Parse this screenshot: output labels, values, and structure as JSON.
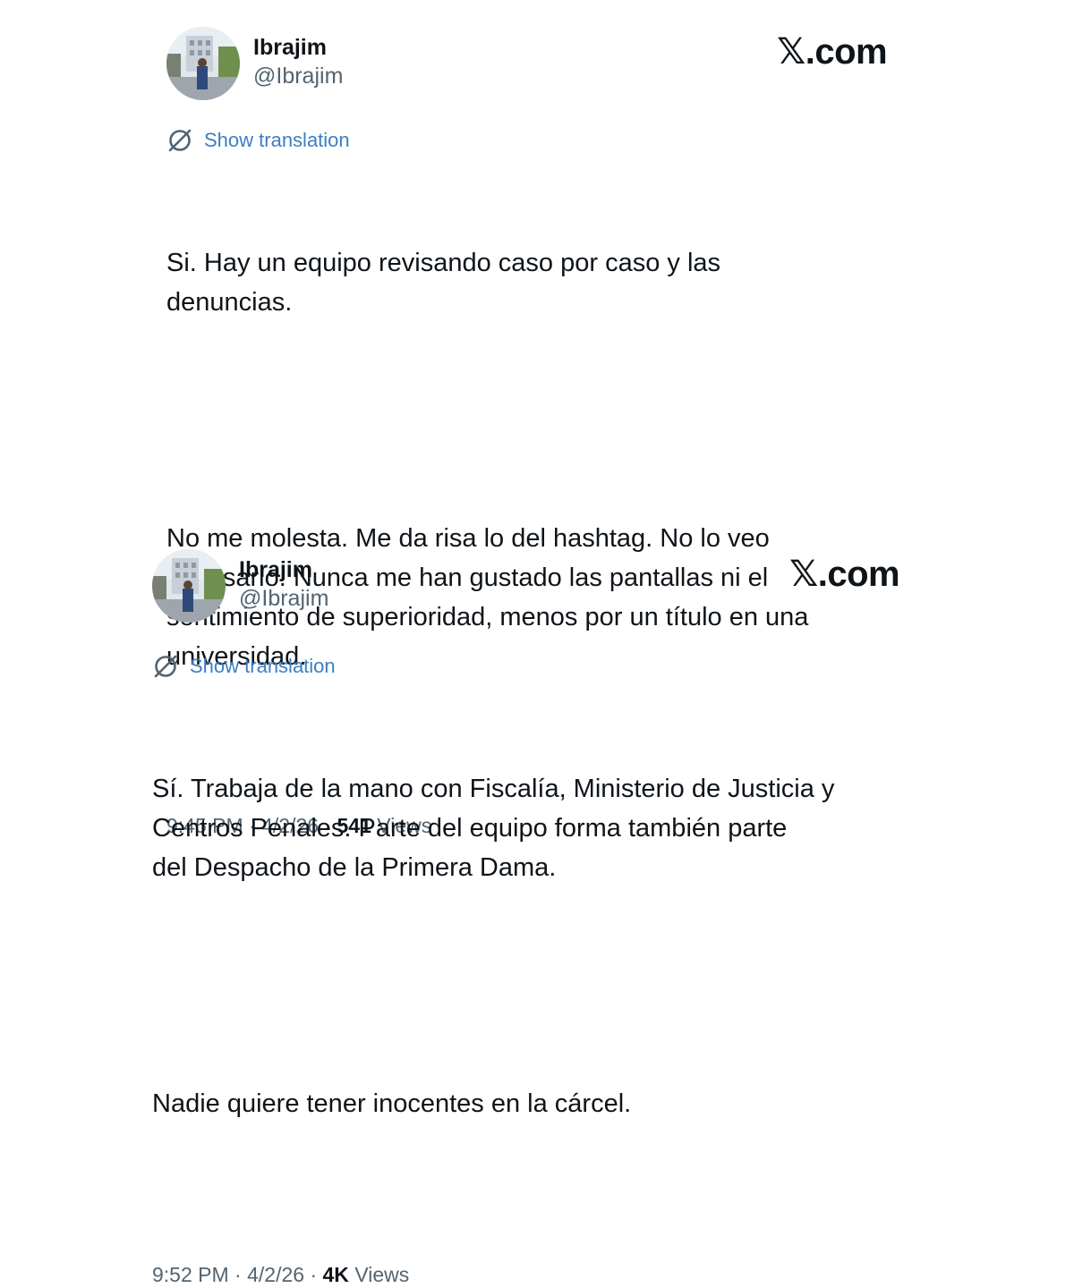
{
  "tweets": [
    {
      "author": {
        "name": "Ibrajim",
        "handle": "@Ibrajim"
      },
      "brand": "𝕏.com",
      "translate_label": "Show translation",
      "paragraphs": [
        "Si. Hay un equipo revisando caso por caso y las\ndenuncias.",
        "No me molesta. Me da risa lo del hashtag. No lo veo\nnecesario. Nunca me han gustado las pantallas ni el\nsentimiento de superioridad, menos por un título en una\nuniversidad."
      ],
      "time": "9:45 PM",
      "date": "4/2/26",
      "separator": "·",
      "views_count": "541",
      "views_label": "Views"
    },
    {
      "author": {
        "name": "Ibrajim",
        "handle": "@Ibrajim"
      },
      "brand": "𝕏.com",
      "translate_label": "Show translation",
      "paragraphs": [
        "Sí. Trabaja de la mano con Fiscalía, Ministerio de Justicia y\nCentros Penales. Parte del equipo forma también parte\ndel Despacho de la Primera Dama.",
        "Nadie quiere tener inocentes en la cárcel."
      ],
      "time": "9:52 PM",
      "date": "4/2/26",
      "separator": "·",
      "views_count": "4K",
      "views_label": "Views"
    }
  ],
  "icons": {
    "avatar": "profile-photo",
    "translate": "translate-globe-icon"
  },
  "colors": {
    "text": "#0f1419",
    "secondary": "#536471",
    "link": "#3b7fc4"
  }
}
